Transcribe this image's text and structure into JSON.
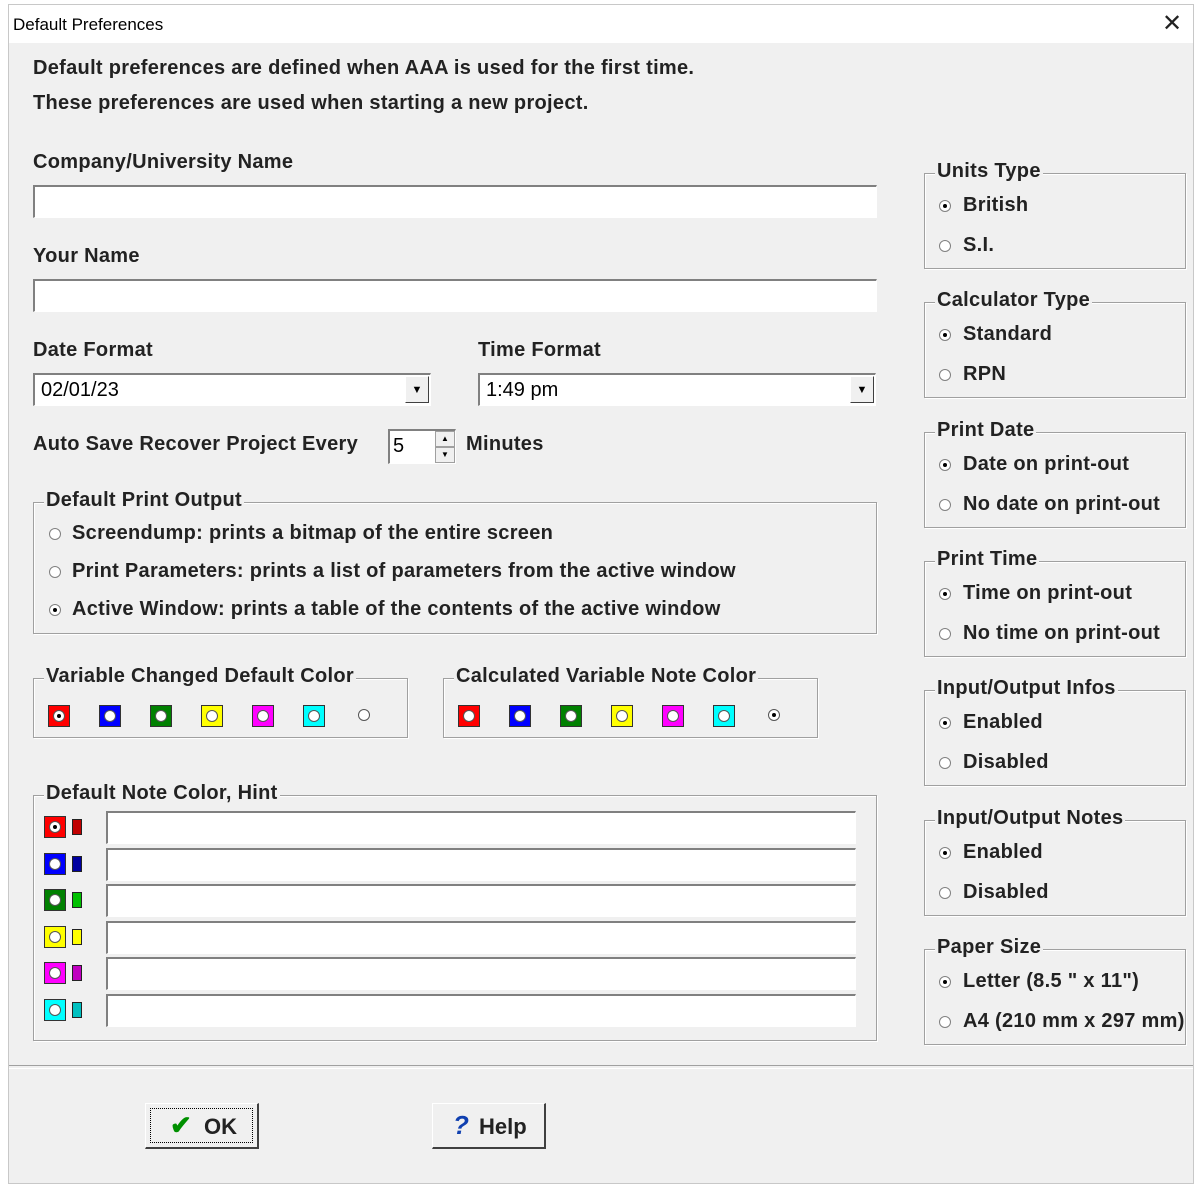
{
  "window": {
    "title": "Default Preferences",
    "close": "✕"
  },
  "intro": {
    "line1": "Default preferences are defined when AAA is used for the first time.",
    "line2": "These preferences are used when starting a new project."
  },
  "company": {
    "label": "Company/University Name",
    "value": ""
  },
  "yourname": {
    "label": "Your Name",
    "value": ""
  },
  "date_format": {
    "label": "Date Format",
    "value": "02/01/23"
  },
  "time_format": {
    "label": "Time Format",
    "value": "1:49 pm"
  },
  "autosave": {
    "label": "Auto Save Recover Project Every",
    "value": "5",
    "unit": "Minutes"
  },
  "print_output": {
    "legend": "Default Print Output",
    "options": [
      "Screendump: prints a bitmap of the entire screen",
      "Print Parameters: prints a list of parameters from the active window",
      "Active Window: prints a table of the contents of the active window"
    ],
    "selected": 2
  },
  "var_changed_color": {
    "legend": "Variable Changed Default Color",
    "colors": [
      "#ff0000",
      "#0000ff",
      "#008000",
      "#ffff00",
      "#ff00ff",
      "#00ffff",
      "#f0f0f0"
    ],
    "selected": 0
  },
  "calc_note_color": {
    "legend": "Calculated Variable Note Color",
    "colors": [
      "#ff0000",
      "#0000ff",
      "#008000",
      "#ffff00",
      "#ff00ff",
      "#00ffff",
      "#f0f0f0"
    ],
    "selected": 6
  },
  "note_hint": {
    "legend": "Default Note Color, Hint",
    "rows": [
      {
        "color": "#ff0000",
        "note_color": "#c00000",
        "value": ""
      },
      {
        "color": "#0000ff",
        "note_color": "#0000a0",
        "value": ""
      },
      {
        "color": "#008000",
        "note_color": "#00c000",
        "value": ""
      },
      {
        "color": "#ffff00",
        "note_color": "#ffff00",
        "value": ""
      },
      {
        "color": "#ff00ff",
        "note_color": "#c000c0",
        "value": ""
      },
      {
        "color": "#00ffff",
        "note_color": "#00c0c0",
        "value": ""
      }
    ],
    "selected": 0
  },
  "units_type": {
    "legend": "Units Type",
    "options": [
      "British",
      "S.I."
    ],
    "selected": 0
  },
  "calculator_type": {
    "legend": "Calculator Type",
    "options": [
      "Standard",
      "RPN"
    ],
    "selected": 0
  },
  "print_date": {
    "legend": "Print Date",
    "options": [
      "Date on print-out",
      "No date on print-out"
    ],
    "selected": 0
  },
  "print_time": {
    "legend": "Print Time",
    "options": [
      "Time on print-out",
      "No time on print-out"
    ],
    "selected": 0
  },
  "io_infos": {
    "legend": "Input/Output Infos",
    "options": [
      "Enabled",
      "Disabled"
    ],
    "selected": 0
  },
  "io_notes": {
    "legend": "Input/Output Notes",
    "options": [
      "Enabled",
      "Disabled"
    ],
    "selected": 0
  },
  "paper_size": {
    "legend": "Paper Size",
    "options": [
      "Letter (8.5 \" x 11\")",
      "A4 (210 mm x 297 mm)"
    ],
    "selected": 0
  },
  "buttons": {
    "ok": "OK",
    "help": "Help",
    "ok_icon": "✔",
    "help_icon": "?"
  }
}
